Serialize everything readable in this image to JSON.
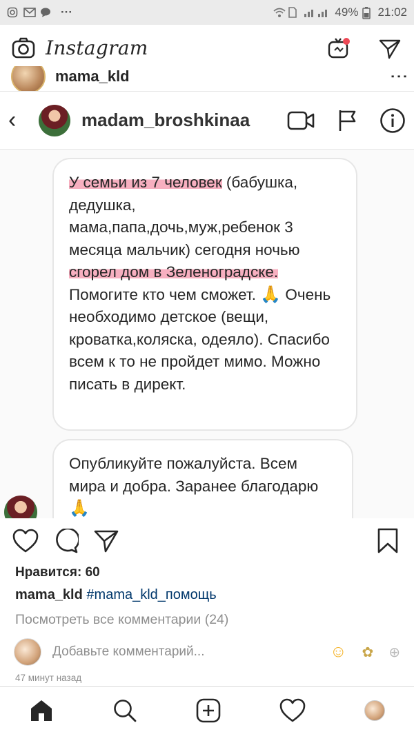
{
  "status_bar": {
    "battery": "49%",
    "time": "21:02",
    "dots": "···"
  },
  "app_header": {
    "logo_text": "Instagram"
  },
  "post": {
    "username": "mama_kld",
    "more": "⋮"
  },
  "dm_screenshot": {
    "back": "‹",
    "username": "madam_broshkinaa",
    "message1": {
      "highlight1": "У семьи из 7 человек",
      "part2": " (бабушка, дедушка, мама,папа,дочь,муж,ребенок 3 месяца мальчик) сегодня ночью ",
      "highlight2": "сгорел дом в Зеленоградске.",
      "part3": " Помогите кто чем сможет. ",
      "emoji": "🙏",
      "part4": " Очень необходимо детское (вещи, кроватка,коляска, одеяло). Спасибо всем к то не пройдет мимо. Можно писать в директ."
    },
    "message2": {
      "text": "Опубликуйте пожалуйста. Всем мира и добра. Заранее благодарю ",
      "emoji": "🙏"
    }
  },
  "likes_text": "Нравится: 60",
  "caption": {
    "username": "mama_kld",
    "hashtag": "#mama_kld_помощь"
  },
  "view_all_comments": "Посмотреть все комментарии (24)",
  "add_comment_placeholder": "Добавьте комментарий...",
  "comment_emojis": [
    "☺",
    "✿",
    "⊕"
  ],
  "timestamp": "47 минут назад",
  "colors": {
    "highlight": "#f06e8c",
    "text": "#262626",
    "muted": "#8e8e8e",
    "link": "#00376b"
  }
}
